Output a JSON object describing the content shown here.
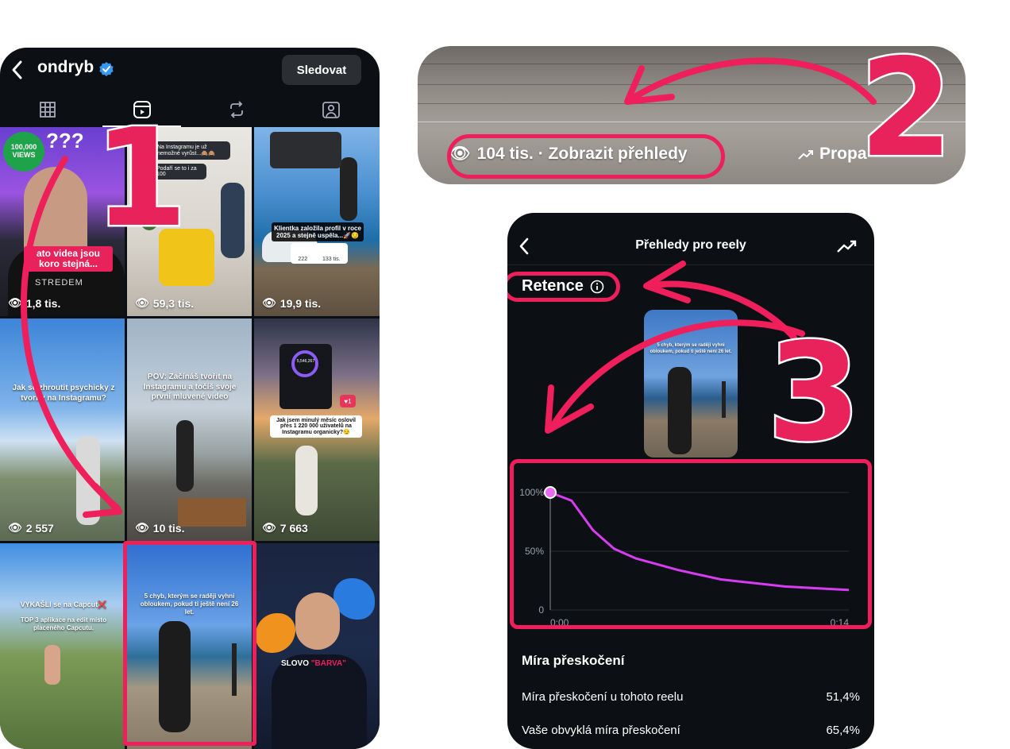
{
  "profile": {
    "username": "ondryb",
    "follow_label": "Sledovat",
    "tabs": [
      "grid-icon",
      "reels-icon",
      "reposts-icon",
      "tagged-icon"
    ],
    "grid": [
      {
        "views": "1,8 tis.",
        "stickers": [
          "100,000 VIEWS",
          "???"
        ],
        "caption": "ato videa jsou koro stejná...",
        "shirt": "STREDEM"
      },
      {
        "views": "59,3 tis.",
        "caption": "Na Instagramu je už nemožné vyrůst...🙈🙈",
        "caption2": "Podaří se to i za 100"
      },
      {
        "views": "19,9 tis.",
        "caption": "Klientka založila profil v roce 2025 a stejně uspěla...🚀😏",
        "stats": [
          "222",
          "133 tis."
        ]
      },
      {
        "views": "2 557",
        "caption": "Jak se zhroutit psychicky z tvorby na Instagramu?"
      },
      {
        "views": "10 tis.",
        "caption": "POV: Začínáš tvořit na Instagramu a točíš svoje první mluvené video"
      },
      {
        "views": "7 663",
        "caption": "Jak jsem minulý měsíc oslovil přes 1 220 000 uživatelů na Instagramu organicky?😏",
        "badge": "1",
        "dash_value": "5,546,267"
      },
      {
        "caption": "VYKAŠLI se na Capcut❌",
        "caption2": "TOP 3 aplikace na edit místo placeného Capcutu."
      },
      {
        "caption": "5 chyb, kterým se raději vyhni obloukem, pokud ti ještě není 26 let."
      },
      {
        "caption": "SLOVO",
        "caption_accent": "\"BARVA\""
      }
    ]
  },
  "reel_bar": {
    "views_text": "104 tis. · Zobrazit přehledy",
    "trend_text": "Propa"
  },
  "insights": {
    "title": "Přehledy pro reely",
    "retention_label": "Retence",
    "thumb_caption": "5 chyb, kterým se raději vyhni obloukem, pokud ti ještě není 26 let.",
    "skip_heading": "Míra přeskočení",
    "skip_rows": [
      {
        "label": "Míra přeskočení u tohoto reelu",
        "value": "51,4%"
      },
      {
        "label": "Vaše obvyklá míra přeskočení",
        "value": "65,4%"
      }
    ]
  },
  "chart_data": {
    "type": "line",
    "x": [
      0,
      1,
      2,
      3,
      4,
      5,
      6,
      7,
      8,
      9,
      10,
      11,
      12,
      13,
      14
    ],
    "series": [
      {
        "values": [
          100,
          93,
          68,
          52,
          44,
          39,
          34,
          30,
          26,
          24,
          22,
          20,
          19,
          18,
          17
        ]
      }
    ],
    "y_ticks": [
      "100%",
      "50%",
      "0"
    ],
    "x_tick_labels": [
      "0:00",
      "0:14"
    ],
    "ylim": [
      0,
      100
    ],
    "grid": true,
    "line_color": "#d63cf0"
  },
  "annotations": {
    "step1": "1",
    "step2": "2",
    "step3": "3",
    "accent": "#ee1f5b"
  }
}
